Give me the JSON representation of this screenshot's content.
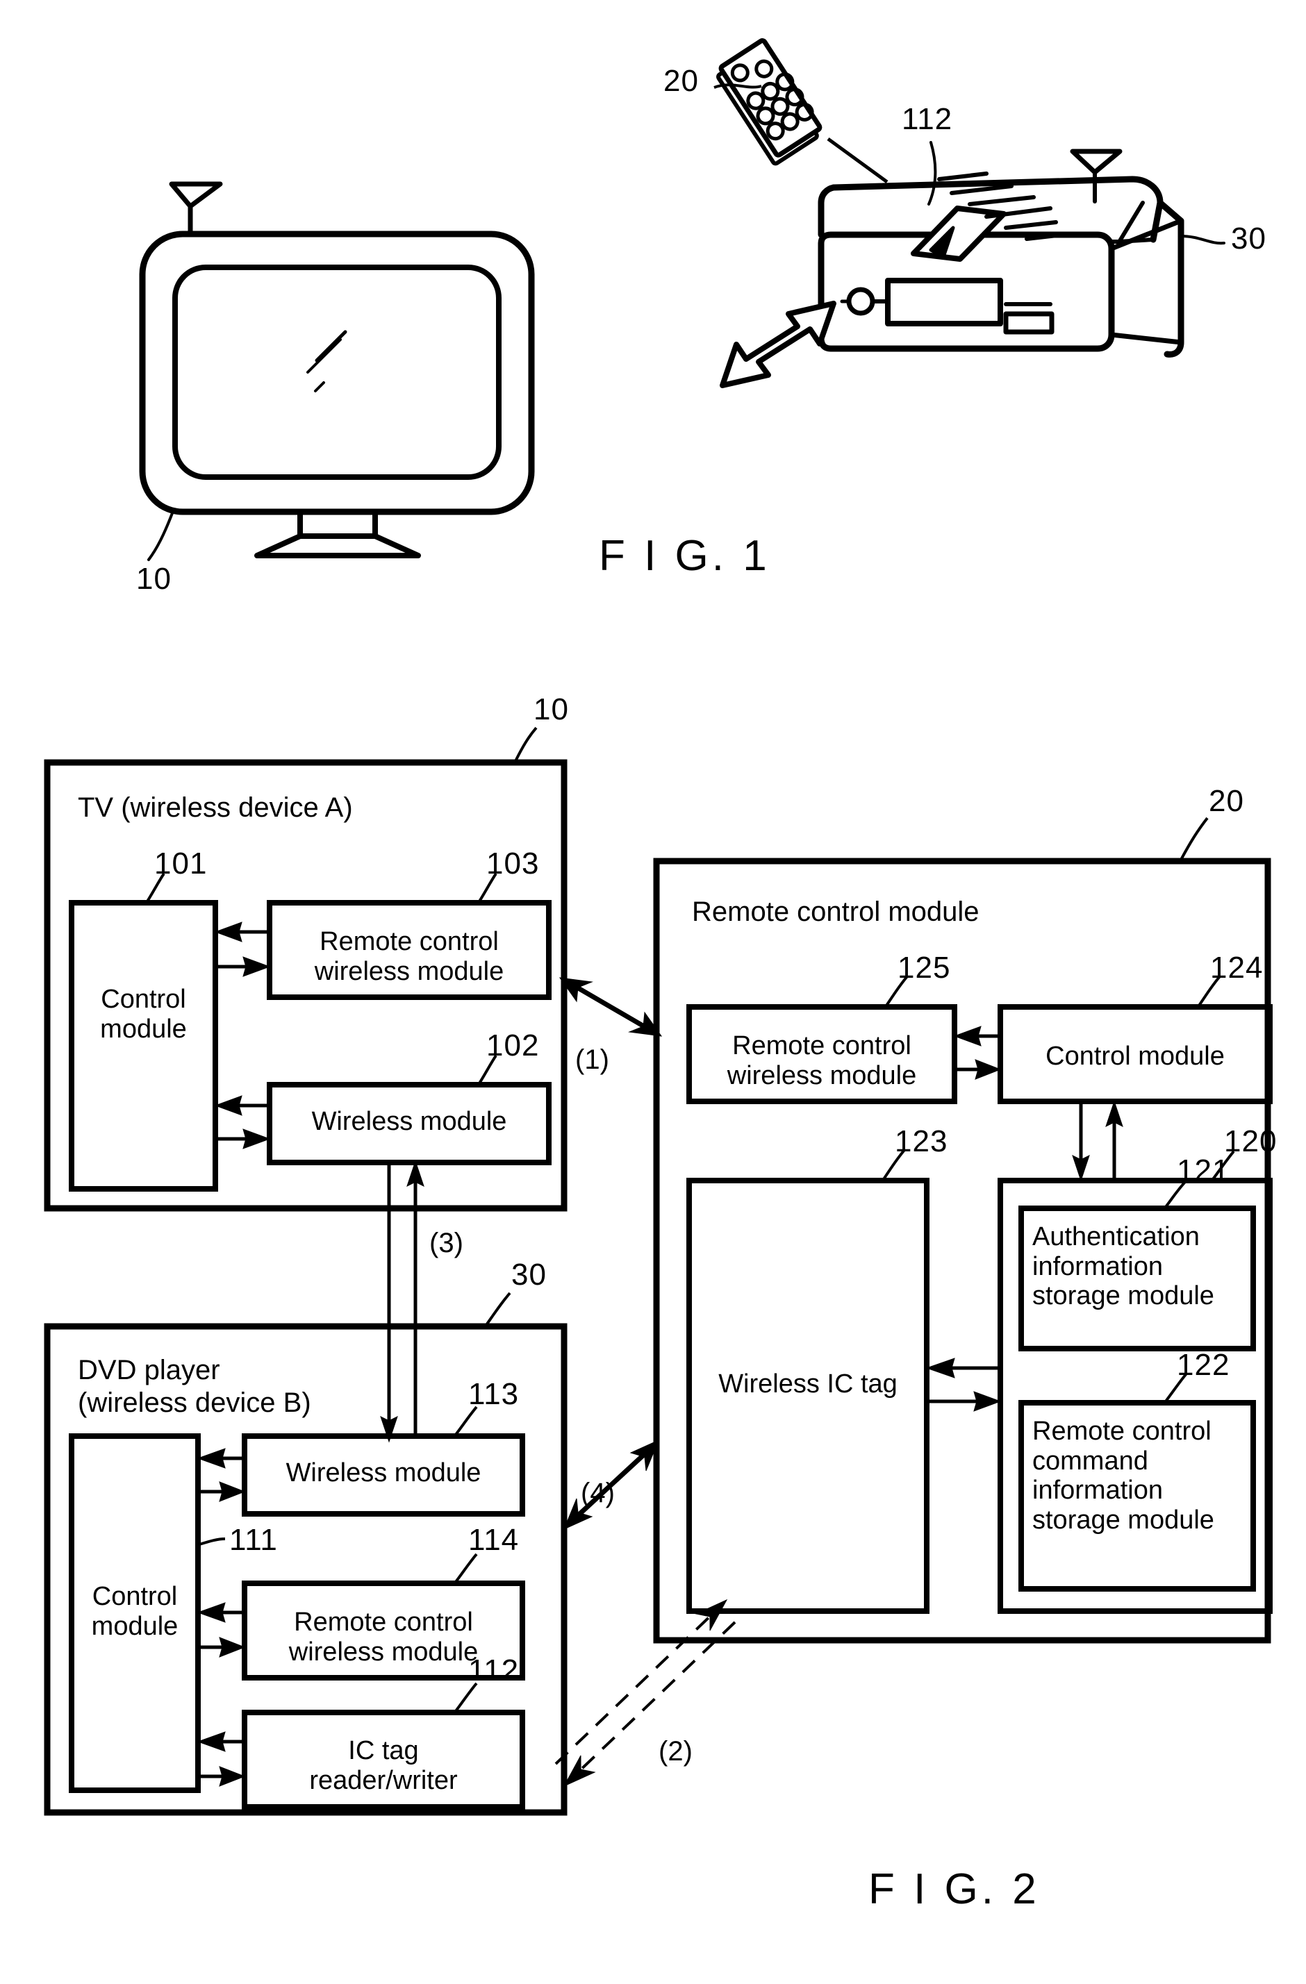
{
  "figures": [
    {
      "id": "fig1",
      "caption": "F I G. 1",
      "ref_numbers": {
        "tv": "10",
        "remote": "20",
        "ic_tag_reader": "112",
        "dvd_player": "30"
      },
      "elements": [
        {
          "name": "television",
          "ref": "10"
        },
        {
          "name": "remote-control",
          "ref": "20"
        },
        {
          "name": "ic-tag-reader-writer-slot",
          "ref": "112"
        },
        {
          "name": "dvd-player",
          "ref": "30"
        }
      ]
    },
    {
      "id": "fig2",
      "caption": "F I G. 2",
      "blocks": {
        "tv": {
          "ref": "10",
          "title": "TV (wireless device A)",
          "children": [
            {
              "ref": "101",
              "label": "Control\nmodule"
            },
            {
              "ref": "103",
              "label": "Remote control\nwireless module"
            },
            {
              "ref": "102",
              "label": "Wireless module"
            }
          ]
        },
        "dvd": {
          "ref": "30",
          "title": "DVD player\n(wireless device B)",
          "children": [
            {
              "ref": "111",
              "label": "Control\nmodule"
            },
            {
              "ref": "113",
              "label": "Wireless module"
            },
            {
              "ref": "114",
              "label": "Remote control\nwireless module"
            },
            {
              "ref": "112",
              "label": "IC tag\nreader/writer"
            }
          ]
        },
        "remote": {
          "ref": "20",
          "title": "Remote control module",
          "children": [
            {
              "ref": "125",
              "label": "Remote control\nwireless module"
            },
            {
              "ref": "124",
              "label": "Control module"
            },
            {
              "ref": "123",
              "label": "Wireless IC tag"
            },
            {
              "ref": "120",
              "label": ""
            },
            {
              "ref": "121",
              "label": "Authentication\ninformation\nstorage module"
            },
            {
              "ref": "122",
              "label": "Remote control\ncommand\ninformation\nstorage module"
            }
          ]
        }
      },
      "connections": [
        {
          "id": "c1",
          "label": "(1)",
          "from": "tv",
          "to": "remote"
        },
        {
          "id": "c2",
          "label": "(2)",
          "from": "ic-tag-reader-writer",
          "to": "wireless-ic-tag"
        },
        {
          "id": "c3",
          "label": "(3)",
          "from": "tv-wireless-module",
          "to": "dvd-wireless-module"
        },
        {
          "id": "c4",
          "label": "(4)",
          "from": "dvd",
          "to": "remote"
        }
      ]
    }
  ],
  "colors": {
    "ink": "#000000",
    "paper": "#ffffff"
  }
}
